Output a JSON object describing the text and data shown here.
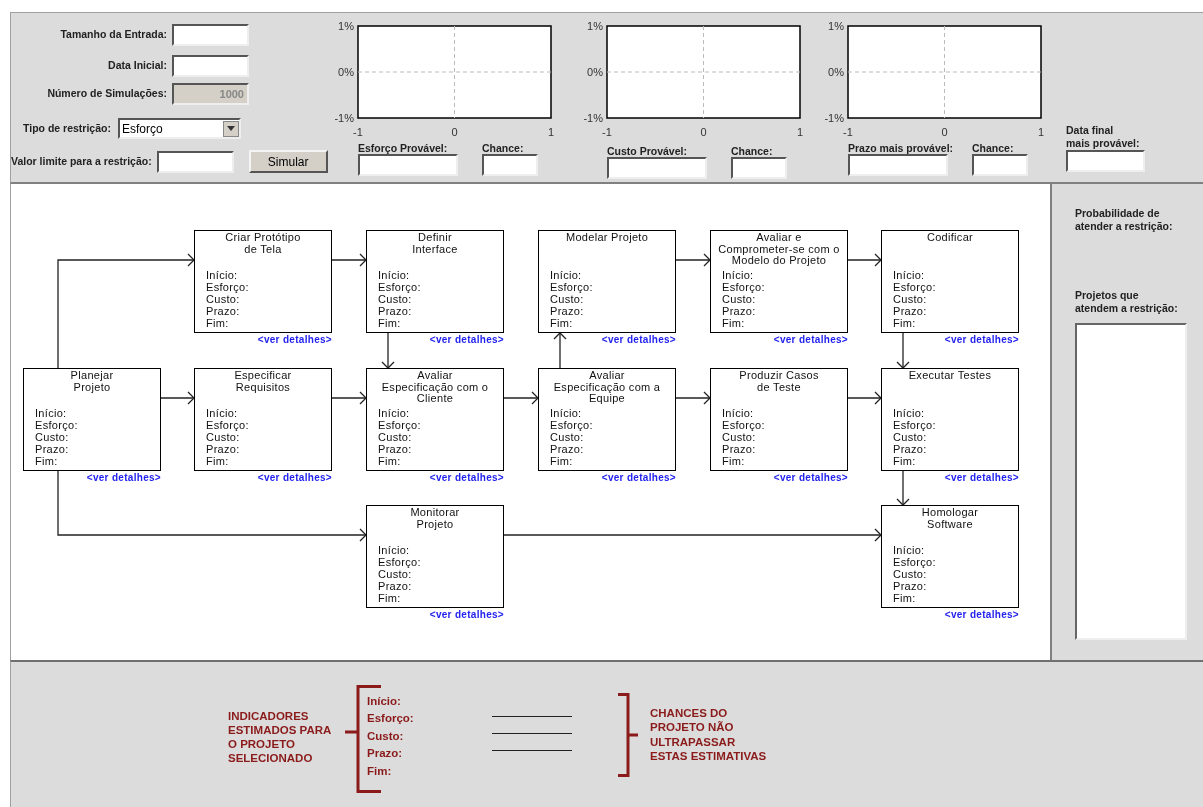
{
  "form": {
    "fields": [
      {
        "label": "Tamanho da Entrada:",
        "disabled": false
      },
      {
        "label": "Data Inicial:",
        "disabled": false
      },
      {
        "label": "Número de Simulações:",
        "value": "1000",
        "disabled": true
      }
    ],
    "restriction_type": {
      "label": "Tipo de restrição:",
      "value": "Esforço"
    },
    "limit": {
      "label": "Valor limite para a restrição:"
    },
    "simulate_button": "Simular"
  },
  "charts": [
    {
      "result_label": "Esforço Provável:",
      "chance_label": "Chance:",
      "chart_data": {
        "type": "line",
        "xlim": [
          -1,
          1
        ],
        "ylim": [
          -1,
          1
        ],
        "xticks": [
          -1,
          0,
          1
        ],
        "yticks": [
          {
            "value": 1,
            "label": "1%"
          },
          {
            "value": 0,
            "label": "0%"
          },
          {
            "value": -1,
            "label": "-1%"
          }
        ]
      }
    },
    {
      "result_label": "Custo Provável:",
      "chance_label": "Chance:",
      "chart_data": {
        "type": "line",
        "xlim": [
          -1,
          1
        ],
        "ylim": [
          -1,
          1
        ],
        "xticks": [
          -1,
          0,
          1
        ],
        "yticks": [
          {
            "value": 1,
            "label": "1%"
          },
          {
            "value": 0,
            "label": "0%"
          },
          {
            "value": -1,
            "label": "-1%"
          }
        ]
      }
    },
    {
      "result_label": "Prazo mais provável:",
      "chance_label": "Chance:",
      "chart_data": {
        "type": "line",
        "xlim": [
          -1,
          1
        ],
        "ylim": [
          -1,
          1
        ],
        "xticks": [
          -1,
          0,
          1
        ],
        "yticks": [
          {
            "value": 1,
            "label": "1%"
          },
          {
            "value": 0,
            "label": "0%"
          },
          {
            "value": -1,
            "label": "-1%"
          }
        ]
      }
    }
  ],
  "final_date_label": "Data final\nmais provável:",
  "nodes": [
    {
      "title": "Criar Protótipo\nde Tela",
      "fields": [
        "Início:",
        "Esforço:",
        "Custo:",
        "Prazo:",
        "Fim:"
      ],
      "link": "<ver detalhes>"
    },
    {
      "title": "Definir\nInterface",
      "fields": [
        "Início:",
        "Esforço:",
        "Custo:",
        "Prazo:",
        "Fim:"
      ],
      "link": "<ver detalhes>"
    },
    {
      "title": "Modelar Projeto",
      "fields": [
        "Início:",
        "Esforço:",
        "Custo:",
        "Prazo:",
        "Fim:"
      ],
      "link": "<ver detalhes>"
    },
    {
      "title": "Avaliar e\nComprometer-se com o\nModelo do Projeto",
      "fields": [
        "Início:",
        "Esforço:",
        "Custo:",
        "Prazo:",
        "Fim:"
      ],
      "link": "<ver detalhes>"
    },
    {
      "title": "Codificar",
      "fields": [
        "Início:",
        "Esforço:",
        "Custo:",
        "Prazo:",
        "Fim:"
      ],
      "link": "<ver detalhes>"
    },
    {
      "title": "Planejar\nProjeto",
      "fields": [
        "Início:",
        "Esforço:",
        "Custo:",
        "Prazo:",
        "Fim:"
      ],
      "link": "<ver detalhes>"
    },
    {
      "title": "Especificar\nRequisitos",
      "fields": [
        "Início:",
        "Esforço:",
        "Custo:",
        "Prazo:",
        "Fim:"
      ],
      "link": "<ver detalhes>"
    },
    {
      "title": "Avaliar\nEspecificação com o\nCliente",
      "fields": [
        "Início:",
        "Esforço:",
        "Custo:",
        "Prazo:",
        "Fim:"
      ],
      "link": "<ver detalhes>"
    },
    {
      "title": "Avaliar\nEspecificação com a\nEquipe",
      "fields": [
        "Início:",
        "Esforço:",
        "Custo:",
        "Prazo:",
        "Fim:"
      ],
      "link": "<ver detalhes>"
    },
    {
      "title": "Produzir Casos\nde Teste",
      "fields": [
        "Início:",
        "Esforço:",
        "Custo:",
        "Prazo:",
        "Fim:"
      ],
      "link": "<ver detalhes>"
    },
    {
      "title": "Executar Testes",
      "fields": [
        "Início:",
        "Esforço:",
        "Custo:",
        "Prazo:",
        "Fim:"
      ],
      "link": "<ver detalhes>"
    },
    {
      "title": "Monitorar\nProjeto",
      "fields": [
        "Início:",
        "Esforço:",
        "Custo:",
        "Prazo:",
        "Fim:"
      ],
      "link": "<ver detalhes>"
    },
    {
      "title": "Homologar\nSoftware",
      "fields": [
        "Início:",
        "Esforço:",
        "Custo:",
        "Prazo:",
        "Fim:"
      ],
      "link": "<ver detalhes>"
    }
  ],
  "side_panel": {
    "probability_label": "Probabilidade de\natender a restrição:",
    "projects_label": "Projetos que\natendem a restrição:"
  },
  "indicators": {
    "title": "INDICADORES\nESTIMADOS PARA\nO PROJETO\nSELECIONADO",
    "fields": [
      "Início:",
      "Esforço:",
      "Custo:",
      "Prazo:",
      "Fim:"
    ],
    "chance_note": "CHANCES DO\nPROJETO NÃO\nULTRAPASSAR\nESTAS ESTIMATIVAS"
  }
}
